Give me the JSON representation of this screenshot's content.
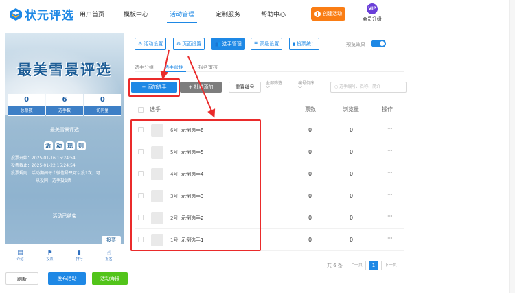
{
  "logo": {
    "text": "状元评选"
  },
  "nav": {
    "items": [
      {
        "label": "用户首页"
      },
      {
        "label": "模板中心"
      },
      {
        "label": "活动管理"
      },
      {
        "label": "定制服务"
      },
      {
        "label": "帮助中心"
      }
    ],
    "active": "活动管理",
    "create_label": "创建活动",
    "vip_badge": "VIP",
    "vip_label": "会员升级"
  },
  "preview": {
    "title": "最美雪景评选",
    "stats": [
      {
        "value": "0",
        "label": "总票数"
      },
      {
        "value": "6",
        "label": "选手数"
      },
      {
        "value": "0",
        "label": "访问量"
      }
    ],
    "activity_name": "最美雪景评选",
    "rules_chars": [
      "活",
      "动",
      "规",
      "则"
    ],
    "info_lines": [
      "投票开始：2025-01-16 15:24:54",
      "投票截止：2025-01-22 15:24:54",
      "投票规则：活动期间每个微信号只可以投1次，可",
      "以投同一选手投1票"
    ],
    "ended_text": "活动已结束",
    "vote_button": "投票",
    "tabbar": [
      {
        "icon": "home-icon",
        "label": "介绍"
      },
      {
        "icon": "flag-icon",
        "label": "投票"
      },
      {
        "icon": "bar-chart-icon",
        "label": "排行"
      },
      {
        "icon": "hand-icon",
        "label": "报名"
      }
    ]
  },
  "bottom_buttons": {
    "refresh": "刷新",
    "publish": "发布活动",
    "poster": "活动海报"
  },
  "toolbar": {
    "buttons": [
      {
        "label": "活动设置",
        "icon": "gear-icon"
      },
      {
        "label": "页面设置",
        "icon": "gear-icon"
      },
      {
        "label": "选手管理",
        "icon": "users-icon"
      },
      {
        "label": "高级设置",
        "icon": "sliders-icon"
      },
      {
        "label": "投票统计",
        "icon": "bar-chart-icon"
      }
    ],
    "active": "选手管理",
    "preview_label": "预览效果",
    "preview_on": true
  },
  "subtabs": {
    "items": [
      "选手分组",
      "选手管理",
      "报名审核"
    ],
    "active": "选手管理"
  },
  "actions": {
    "add": "+ 添加选手",
    "batch": "+ 批量添加",
    "renumber": "重置编号",
    "filter_all": "全部筛选",
    "sort": "编号倒序",
    "search_placeholder": "选手编号、名称、简介"
  },
  "table": {
    "columns": {
      "player": "选手",
      "votes": "票数",
      "views": "浏览量",
      "ops": "操作"
    },
    "rows": [
      {
        "num": "6号",
        "name": "示例选手6",
        "votes": "0",
        "views": "0",
        "ops": "···"
      },
      {
        "num": "5号",
        "name": "示例选手5",
        "votes": "0",
        "views": "0",
        "ops": "···"
      },
      {
        "num": "4号",
        "name": "示例选手4",
        "votes": "0",
        "views": "0",
        "ops": "···"
      },
      {
        "num": "3号",
        "name": "示例选手3",
        "votes": "0",
        "views": "0",
        "ops": "···"
      },
      {
        "num": "2号",
        "name": "示例选手2",
        "votes": "0",
        "views": "0",
        "ops": "···"
      },
      {
        "num": "1号",
        "name": "示例选手1",
        "votes": "0",
        "views": "0",
        "ops": "···"
      }
    ]
  },
  "pagination": {
    "total": "共 6 条",
    "prev": "上一页",
    "current": "1",
    "next": "下一页"
  },
  "colors": {
    "primary": "#1e88e5",
    "orange": "#fa7d14",
    "green": "#52c41a",
    "annotation": "#ea2b2b"
  }
}
